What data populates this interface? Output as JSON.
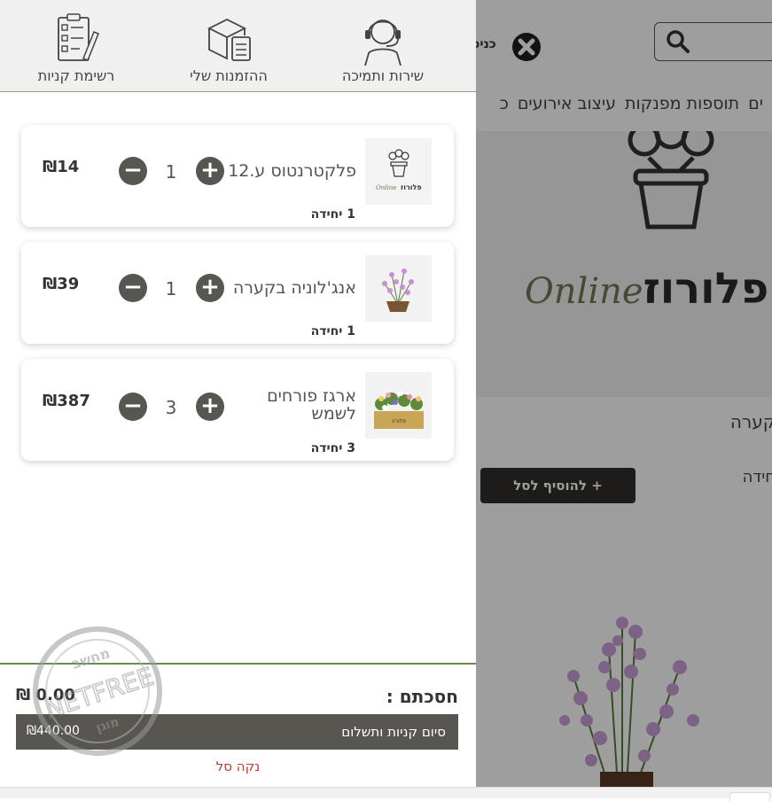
{
  "colors": {
    "accent_dark": "#575650",
    "divider_green": "#6d8b4e",
    "clear_link_red": "#c0392b",
    "overlay": "rgba(0,0,0,0.38)"
  },
  "header": {
    "support_label": "שירות ותמיכה",
    "orders_label": "ההזמנות שלי",
    "shopping_list_label": "רשימת קניות",
    "support_icon": "headset-agent-icon",
    "orders_icon": "box-clipboard-icon",
    "shopping_list_icon": "checklist-pencil-icon"
  },
  "cart": {
    "items": [
      {
        "name": "פלקטרנטוס ע.12",
        "qty": "1",
        "units": "1 יחידה",
        "price": "₪14",
        "image": "flower-pot-logo-thumb"
      },
      {
        "name": "אנג'לוניה בקערה",
        "qty": "1",
        "units": "1 יחידה",
        "price": "₪39",
        "image": "angelonia-bowl-thumb"
      },
      {
        "name": "ארגז פורחים לשמש",
        "qty": "3",
        "units": "3 יחידה",
        "price": "₪387",
        "image": "flower-crate-thumb"
      }
    ],
    "minus_symbol": "−",
    "plus_symbol": "+"
  },
  "summary": {
    "total_label": "חסכתם :",
    "total_value": "₪ 0.00",
    "checkout_label": "סיום קניות ותשלום",
    "checkout_amount": "₪440.00",
    "clear_label": "נקה סל"
  },
  "background_page": {
    "login_label": "כניסו",
    "search_icon": "search-icon",
    "nav_items": [
      "ים",
      "תוספות מפנקות",
      "עיצוב אירועים",
      "כ"
    ],
    "logo_script": "Online",
    "logo_text": "פלורוז",
    "product_name_partial": "קערה",
    "unit_partial": "חידה",
    "add_to_cart_label": "+ להוסיף לסל"
  },
  "watermark": {
    "top": "מחשב",
    "middle": "NETFREE",
    "bottom": "מוגן"
  }
}
